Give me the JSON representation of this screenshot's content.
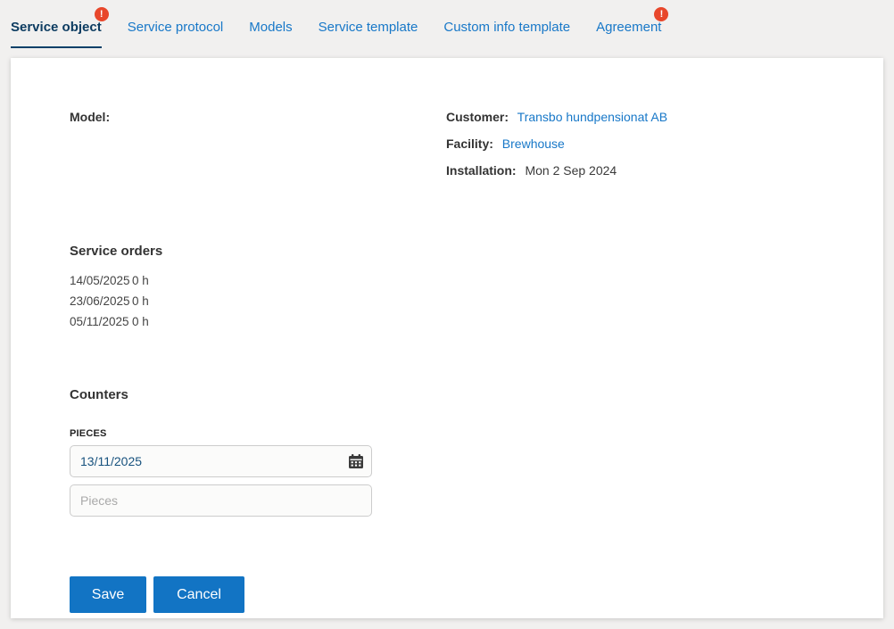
{
  "tabs": [
    {
      "label": "Service object",
      "active": true,
      "badge": "!"
    },
    {
      "label": "Service protocol"
    },
    {
      "label": "Models"
    },
    {
      "label": "Service template"
    },
    {
      "label": "Custom info template"
    },
    {
      "label": "Agreement",
      "badge": "!"
    }
  ],
  "details": {
    "model_label": "Model:",
    "customer_label": "Customer:",
    "customer_value": "Transbo hundpensionat AB",
    "facility_label": "Facility:",
    "facility_value": "Brewhouse",
    "installation_label": "Installation:",
    "installation_value": "Mon 2 Sep 2024"
  },
  "service_orders": {
    "heading": "Service orders",
    "rows": [
      {
        "date": "14/05/2025",
        "hours": "0 h"
      },
      {
        "date": "23/06/2025",
        "hours": "0 h"
      },
      {
        "date": "05/11/2025",
        "hours": "0 h"
      }
    ]
  },
  "counters": {
    "heading": "Counters",
    "field_label": "PIECES",
    "date_value": "13/11/2025",
    "pieces_placeholder": "Pieces",
    "calendar_icon": "calendar-icon"
  },
  "actions": {
    "save_label": "Save",
    "cancel_label": "Cancel"
  },
  "colors": {
    "link_blue": "#1878c8",
    "button_blue": "#1274c4",
    "active_tab_navy": "#0d3c61",
    "badge_red": "#e8472b",
    "page_background": "#f1f0ef",
    "panel_background": "#ffffff"
  }
}
